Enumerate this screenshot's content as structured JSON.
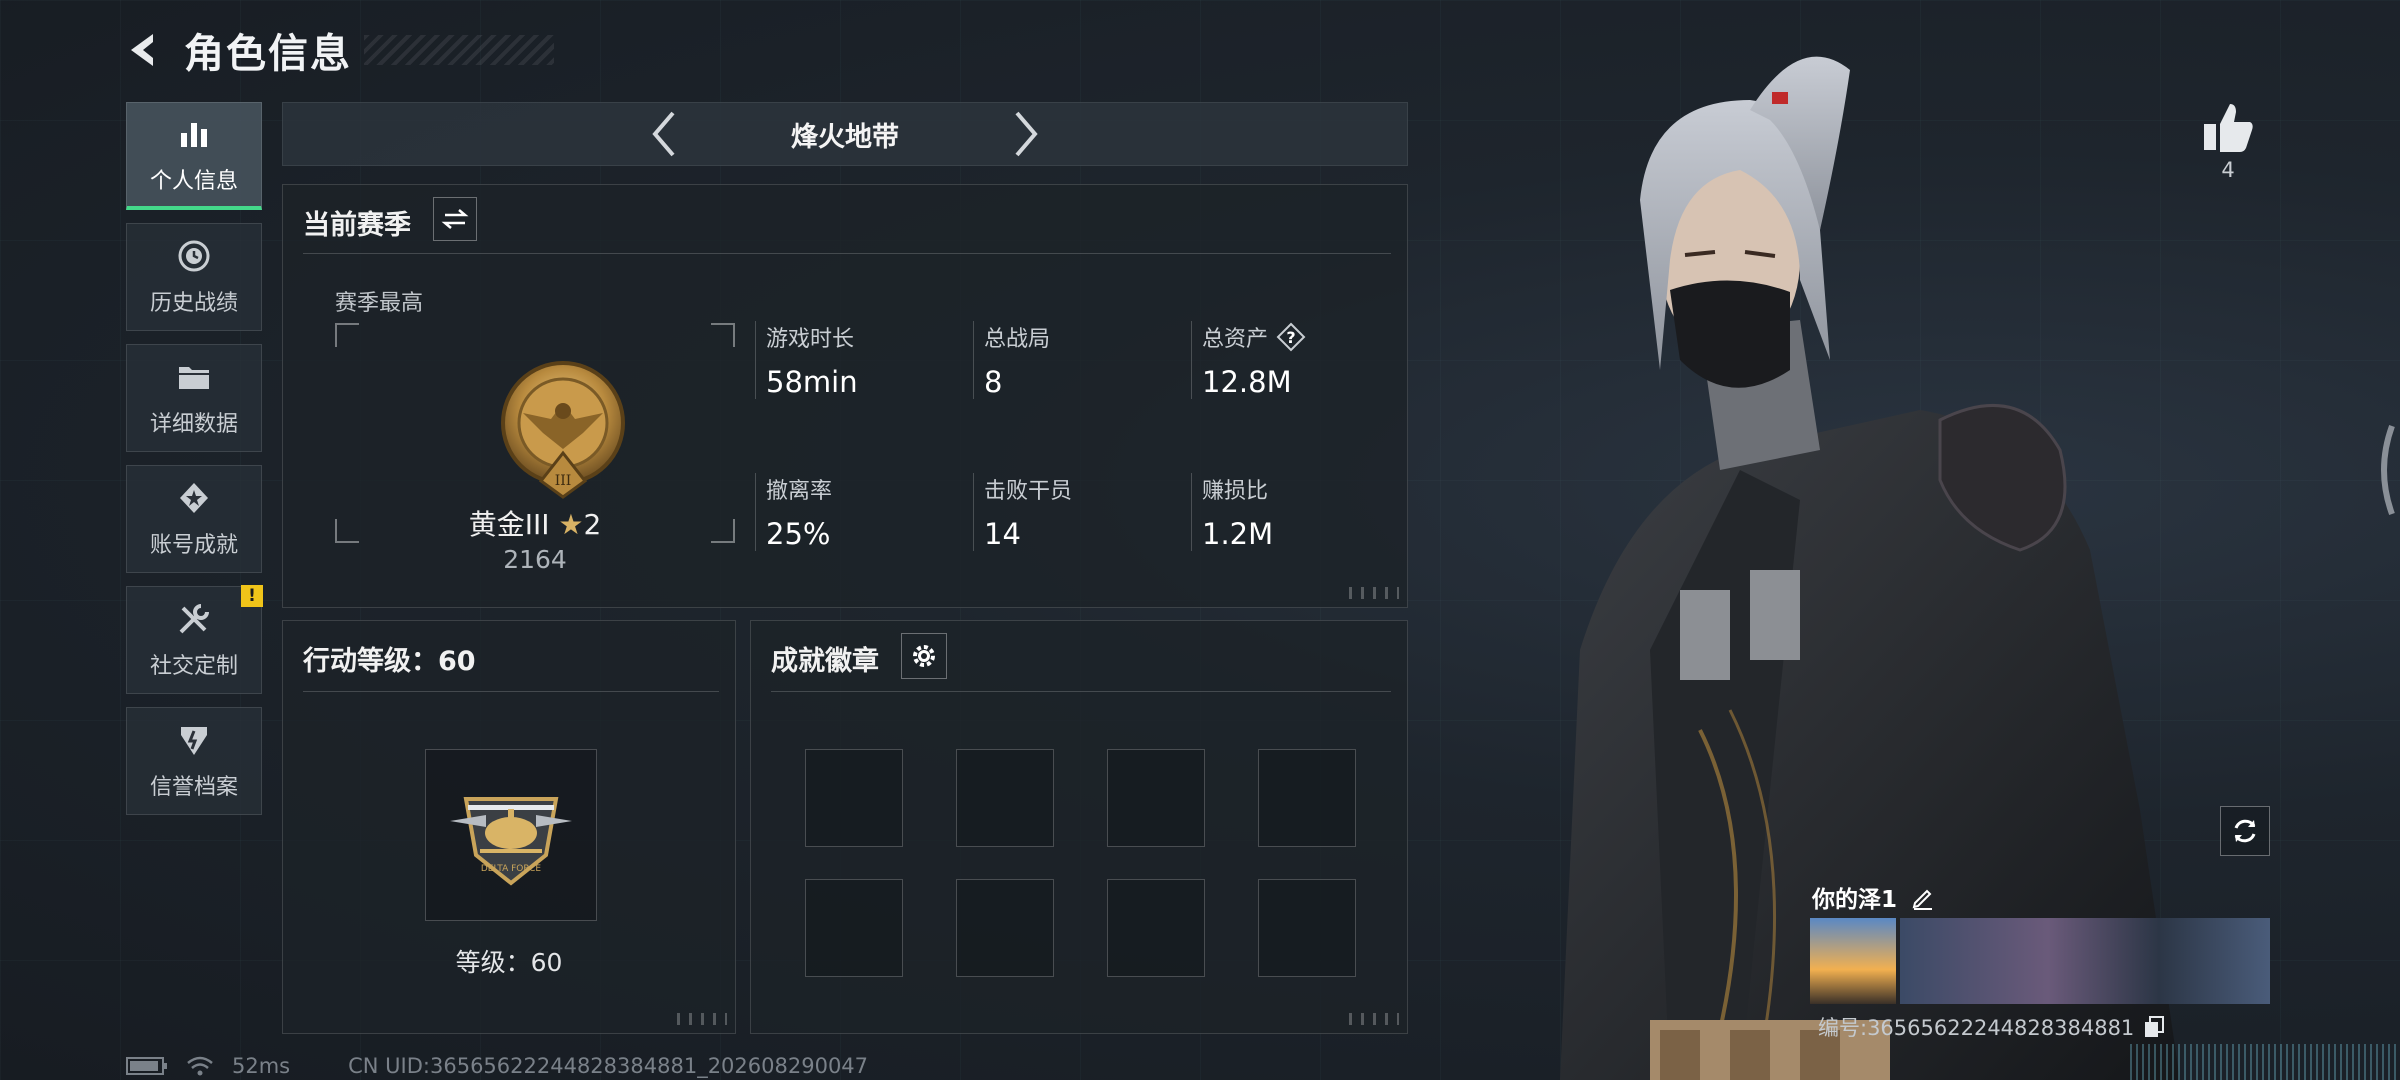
{
  "header": {
    "title": "角色信息"
  },
  "nav": {
    "items": [
      {
        "label": "个人信息",
        "icon": "bar-chart-icon",
        "active": true
      },
      {
        "label": "历史战绩",
        "icon": "history-icon"
      },
      {
        "label": "详细数据",
        "icon": "folder-icon"
      },
      {
        "label": "账号成就",
        "icon": "achievement-icon"
      },
      {
        "label": "社交定制",
        "icon": "tools-icon",
        "notice": "!"
      },
      {
        "label": "信誉档案",
        "icon": "shield-icon"
      }
    ]
  },
  "mode": {
    "name": "烽火地带"
  },
  "season": {
    "title": "当前赛季",
    "best_label": "赛季最高",
    "rank_name": "黄金III",
    "stars": "2",
    "rank_score": "2164",
    "stats": [
      {
        "label": "游戏时长",
        "value": "58min"
      },
      {
        "label": "总战局",
        "value": "8"
      },
      {
        "label": "总资产",
        "value": "12.8M",
        "help": true
      },
      {
        "label": "撤离率",
        "value": "25%"
      },
      {
        "label": "击败干员",
        "value": "14"
      },
      {
        "label": "赚损比",
        "value": "1.2M"
      }
    ]
  },
  "level": {
    "title": "行动等级：60",
    "level_text": "等级：60"
  },
  "achievements": {
    "title": "成就徽章",
    "slot_count": 8
  },
  "status": {
    "ping": "52ms",
    "uid": "CN UID:365656222448283848​81_202608290047"
  },
  "profile": {
    "like_count": "4"
  },
  "card": {
    "name": "你的泽1",
    "id": "编号:36565622244828384881"
  },
  "colors": {
    "active_accent": "#44d98a",
    "notice": "#f0c419"
  }
}
